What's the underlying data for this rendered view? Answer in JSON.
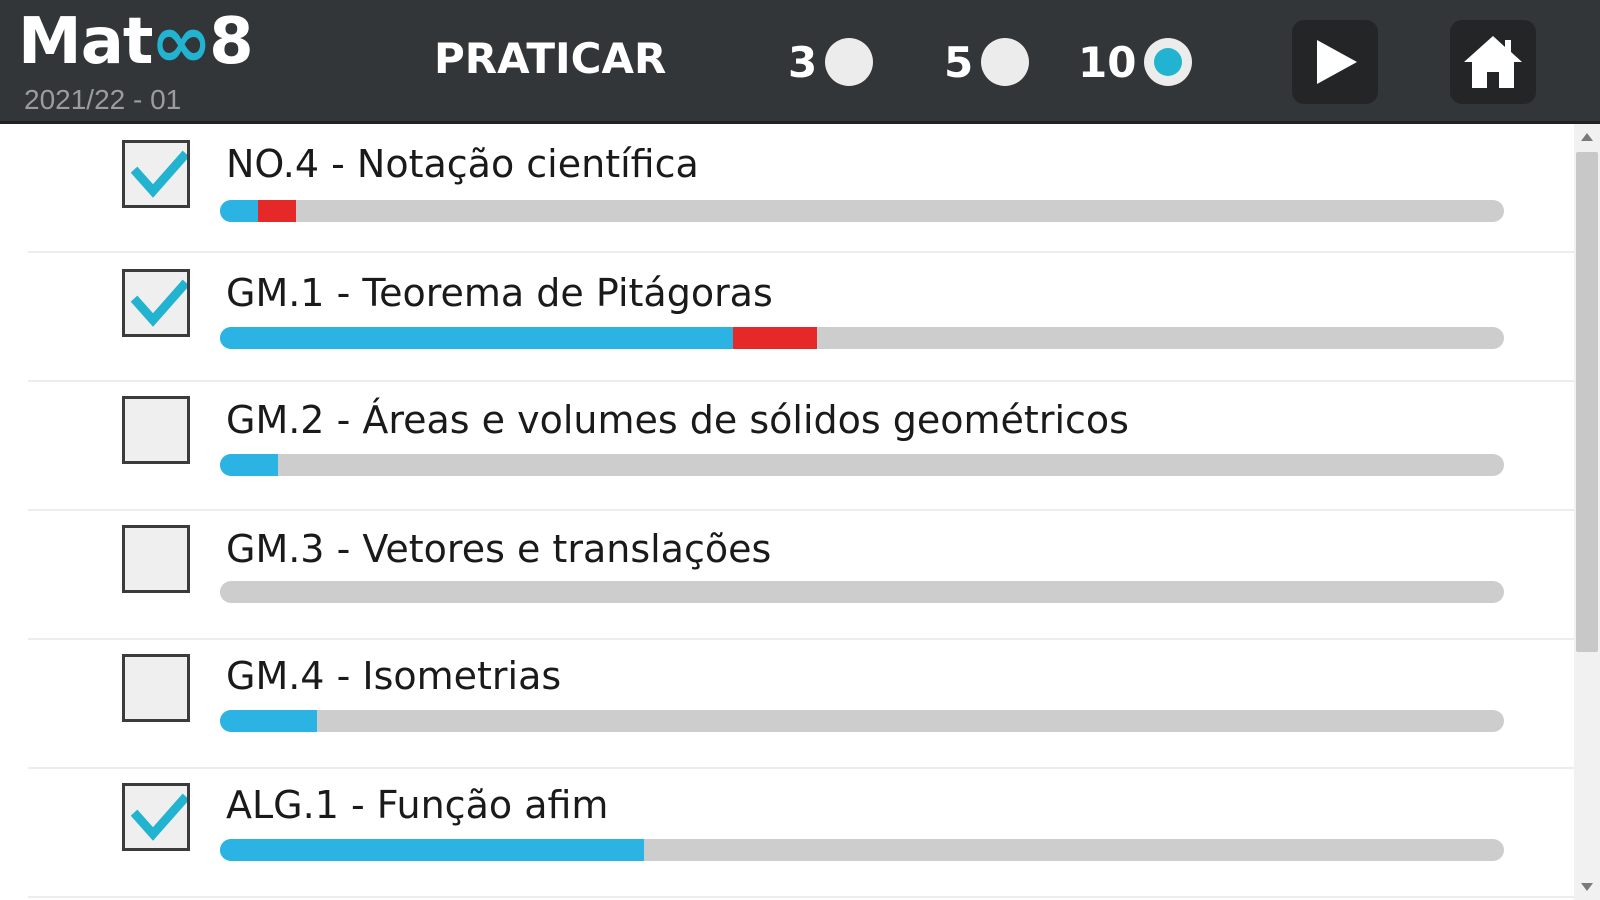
{
  "header": {
    "logo_text_left": "Mat",
    "logo_infinity": "∞",
    "logo_text_right": "8",
    "school_year": "2021/22 - 01",
    "mode_title": "PRATICAR",
    "counts": [
      {
        "label": "3",
        "selected": false
      },
      {
        "label": "5",
        "selected": false
      },
      {
        "label": "10",
        "selected": true
      }
    ],
    "play_icon": "play-icon",
    "home_icon": "home-icon"
  },
  "colors": {
    "header_bg": "#333639",
    "accent": "#21b3d0",
    "progress_blue": "#2bb3e3",
    "progress_red": "#e52828",
    "progress_track": "#cdcdcd"
  },
  "topics": [
    {
      "title": "NO.4 - Notação científica",
      "checked": true,
      "progress_blue": 0.03,
      "progress_red": 0.03
    },
    {
      "title": "GM.1 - Teorema de Pitágoras",
      "checked": true,
      "progress_blue": 0.4,
      "progress_red": 0.065
    },
    {
      "title": "GM.2 - Áreas e volumes de sólidos geométricos",
      "checked": false,
      "progress_blue": 0.045,
      "progress_red": 0
    },
    {
      "title": "GM.3 - Vetores e translações",
      "checked": false,
      "progress_blue": 0,
      "progress_red": 0
    },
    {
      "title": "GM.4 - Isometrias",
      "checked": false,
      "progress_blue": 0.075,
      "progress_red": 0
    },
    {
      "title": "ALG.1 - Função afim",
      "checked": true,
      "progress_blue": 0.33,
      "progress_red": 0
    }
  ]
}
